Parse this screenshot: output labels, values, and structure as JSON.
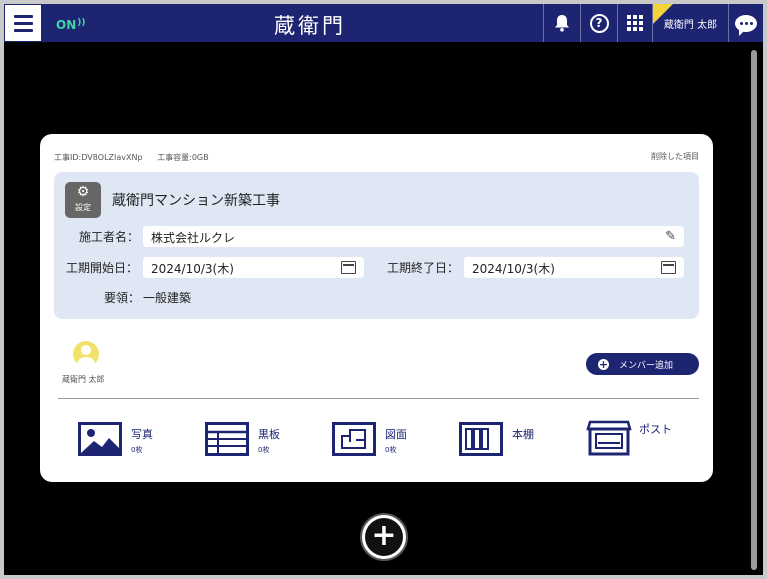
{
  "header": {
    "status": "ON",
    "logo": "蔵衛門",
    "user_name": "蔵衛門 太郎",
    "icons": [
      "menu-icon",
      "bell-icon",
      "help-icon",
      "apps-grid-icon",
      "chat-icon"
    ]
  },
  "project": {
    "id_text": "工事ID:DV8OLZIavXNp",
    "capacity_text": "工事容量:0GB",
    "deleted_link": "削除した項目",
    "settings_label": "設定",
    "title": "蔵衛門マンション新築工事",
    "contractor_label": "施工者名：",
    "contractor_value": "株式会社ルクレ",
    "start_label": "工期開始日：",
    "start_value": "2024/10/3(木)",
    "end_label": "工期終了日：",
    "end_value": "2024/10/3(木)",
    "summary_label": "要領：",
    "summary_value": "一般建築"
  },
  "members": {
    "name": "蔵衛門 太郎",
    "add_button": "メンバー追加"
  },
  "modules": [
    {
      "label": "写真",
      "count": "0枚"
    },
    {
      "label": "黒板",
      "count": "0枚"
    },
    {
      "label": "図面",
      "count": "0枚"
    },
    {
      "label": "本棚",
      "count": ""
    },
    {
      "label": "ポスト",
      "count": ""
    }
  ],
  "colors": {
    "primary": "#1d2472",
    "panel": "#dfe7f5",
    "status_on": "#3fd6a4"
  }
}
